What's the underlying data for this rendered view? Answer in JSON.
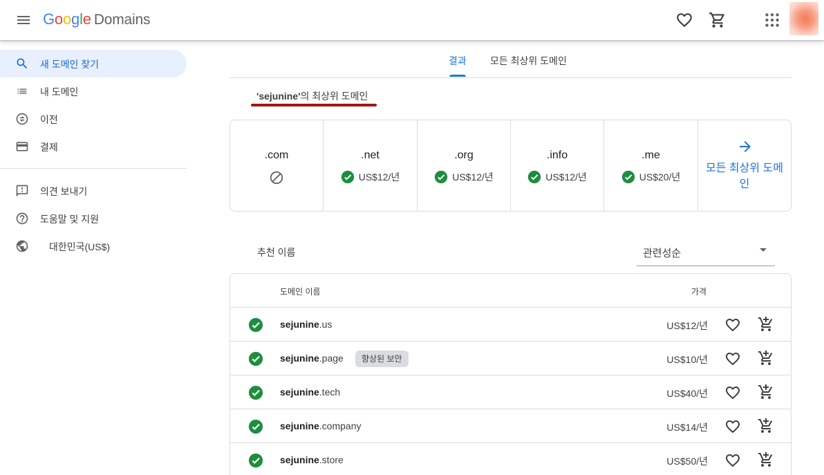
{
  "header": {
    "logo_letters": [
      "G",
      "o",
      "o",
      "g",
      "l",
      "e"
    ],
    "product": "Domains"
  },
  "sidebar": {
    "items": [
      {
        "label": "새 도메인 찾기",
        "icon": "search-icon"
      },
      {
        "label": "내 도메인",
        "icon": "list-icon"
      },
      {
        "label": "이전",
        "icon": "transfer-icon"
      },
      {
        "label": "결제",
        "icon": "credit-card-icon"
      },
      {
        "label": "의견 보내기",
        "icon": "feedback-icon"
      },
      {
        "label": "도움말 및 지원",
        "icon": "help-icon"
      },
      {
        "label": "대한민국(US$)",
        "icon": "globe-icon"
      }
    ]
  },
  "tabs": [
    {
      "label": "결과",
      "active": true
    },
    {
      "label": "모든 최상위 도메인",
      "active": false
    }
  ],
  "tld_section": {
    "query": "'sejunine'",
    "suffix": "의 최상위 도메인",
    "tlds": [
      {
        "name": ".com",
        "available": false,
        "price": ""
      },
      {
        "name": ".net",
        "available": true,
        "price": "US$12/년"
      },
      {
        "name": ".org",
        "available": true,
        "price": "US$12/년"
      },
      {
        "name": ".info",
        "available": true,
        "price": "US$12/년"
      },
      {
        "name": ".me",
        "available": true,
        "price": "US$20/년"
      }
    ],
    "all_tlds_label": "모든 최상위 도메인"
  },
  "suggestions": {
    "label": "추천 이름",
    "sort_value": "관련성순",
    "header_name": "도메인 이름",
    "header_price": "가격",
    "rows": [
      {
        "name": "sejunine",
        "tld": ".us",
        "badge": "",
        "price": "US$12/년"
      },
      {
        "name": "sejunine",
        "tld": ".page",
        "badge": "향상된 보안",
        "price": "US$10/년"
      },
      {
        "name": "sejunine",
        "tld": ".tech",
        "badge": "",
        "price": "US$40/년"
      },
      {
        "name": "sejunine",
        "tld": ".company",
        "badge": "",
        "price": "US$14/년"
      },
      {
        "name": "sejunine",
        "tld": ".store",
        "badge": "",
        "price": "US$50/년"
      }
    ]
  },
  "colors": {
    "accent": "#1a73e8",
    "available_green": "#1e8e3e",
    "underline_red": "#a3160f"
  }
}
